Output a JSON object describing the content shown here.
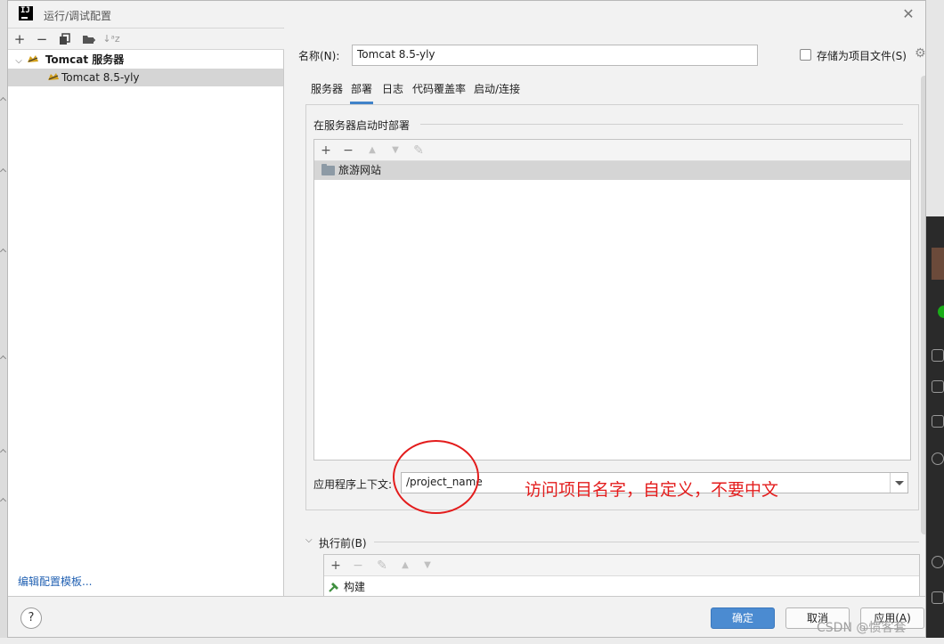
{
  "window": {
    "title": "运行/调试配置",
    "app_icon": "IJ"
  },
  "left": {
    "toolbar": {
      "add": "+",
      "remove": "−",
      "copy_icon": "copy-icon",
      "folder_icon": "new-folder-icon",
      "sort_icon": "sort-icon",
      "sort": "↓ᵃz"
    },
    "tree": [
      {
        "label": "Tomcat 服务器",
        "expanded": true,
        "bold": true
      },
      {
        "label": "Tomcat 8.5-yly",
        "selected": true
      }
    ],
    "edit_templates_link": "编辑配置模板..."
  },
  "config": {
    "name_label": "名称(N):",
    "name_value": "Tomcat 8.5-yly",
    "store_as_file_label": "存储为项目文件(S)",
    "store_as_file_checked": false,
    "tabs": [
      {
        "label": "服务器",
        "active": false
      },
      {
        "label": "部署",
        "active": true
      },
      {
        "label": "日志",
        "active": false
      },
      {
        "label": "代码覆盖率",
        "active": false
      },
      {
        "label": "启动/连接",
        "active": false
      }
    ],
    "deploy_section_title": "在服务器启动时部署",
    "deploy_toolbar": {
      "add": "+",
      "remove": "−",
      "up": "▲",
      "down": "▼",
      "edit": "✎"
    },
    "deploy_items": [
      {
        "label": "旅游网站",
        "icon": "folder-icon",
        "selected": true
      }
    ],
    "context_label": "应用程序上下文:",
    "context_value": "/project_name",
    "annotation": "访问项目名字，自定义，不要中文",
    "before_launch_label": "执行前(B)",
    "before_launch_toolbar": {
      "add": "+",
      "remove": "−",
      "edit": "✎",
      "up": "▲",
      "down": "▼"
    },
    "before_launch_items": [
      {
        "label": "构建",
        "icon": "hammer-icon"
      }
    ]
  },
  "footer": {
    "help": "?",
    "ok": "确定",
    "cancel": "取消",
    "apply": "应用(A)"
  },
  "watermark": "CSDN @惯客套",
  "colors": {
    "primary_button": "#4b8bd1",
    "tab_underline": "#4083c9",
    "annotation": "#e31c1c",
    "link": "#2362b3"
  }
}
